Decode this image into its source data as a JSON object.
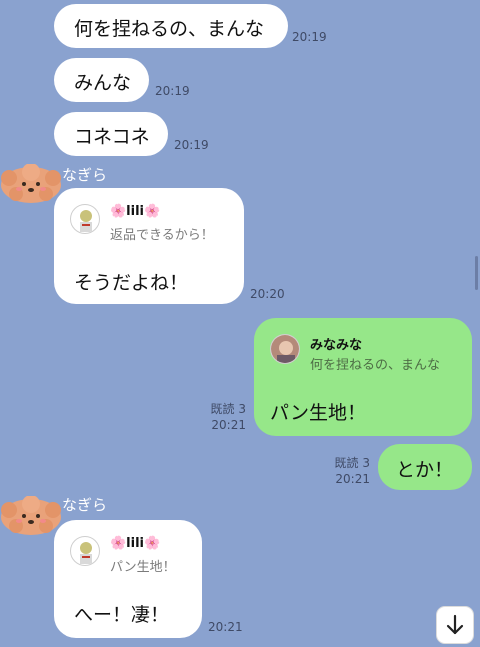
{
  "messages": [
    {
      "text": "何を捏ねるの、まんな",
      "time": "20:19"
    },
    {
      "text": "みんな",
      "time": "20:19"
    },
    {
      "text": "コネコネ",
      "time": "20:19"
    },
    {
      "sender": "なぎら",
      "reply": {
        "name": "🌸lili🌸",
        "text": "返品できるから！"
      },
      "text": "そうだよね！",
      "time": "20:20"
    },
    {
      "reply": {
        "name": "みなみな",
        "text": "何を捏ねるの、まんな"
      },
      "text": "パン生地！",
      "read": "既読 3",
      "time": "20:21"
    },
    {
      "text": "とか！",
      "read": "既読 3",
      "time": "20:21"
    },
    {
      "sender": "なぎら",
      "reply": {
        "name": "🌸lili🌸",
        "text": "パン生地！"
      },
      "text": "へー！凄！",
      "time": "20:21"
    }
  ],
  "colors": {
    "background": "#8aa2cf",
    "incoming_bubble": "#ffffff",
    "outgoing_bubble": "#96e789"
  },
  "icons": {
    "avatar": "fluffy-dog-avatar-icon",
    "scroll_down": "arrow-down-icon"
  }
}
